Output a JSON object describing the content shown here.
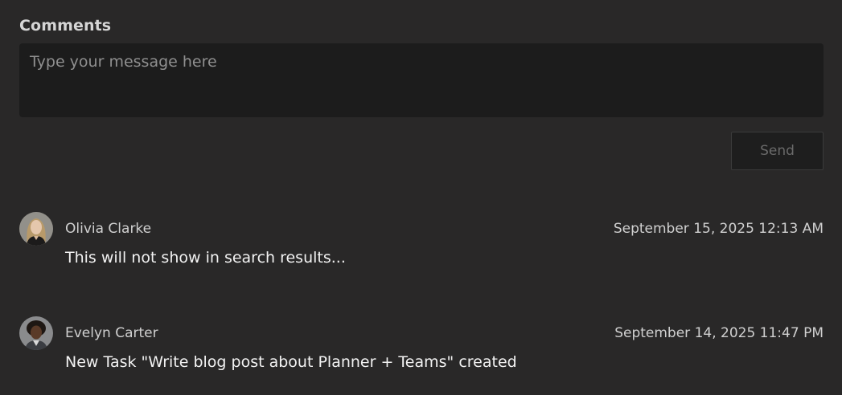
{
  "comments_section": {
    "heading": "Comments",
    "composer": {
      "placeholder": "Type your message here",
      "value": ""
    },
    "send_label": "Send"
  },
  "comments": [
    {
      "author": "Olivia Clarke",
      "timestamp": "September 15, 2025 12:13 AM",
      "text": "This will not show in search results...",
      "avatar_icon": "user-photo-olivia"
    },
    {
      "author": "Evelyn Carter",
      "timestamp": "September 14, 2025 11:47 PM",
      "text": "New Task \"Write blog post about Planner + Teams\" created",
      "avatar_icon": "user-photo-evelyn"
    }
  ]
}
